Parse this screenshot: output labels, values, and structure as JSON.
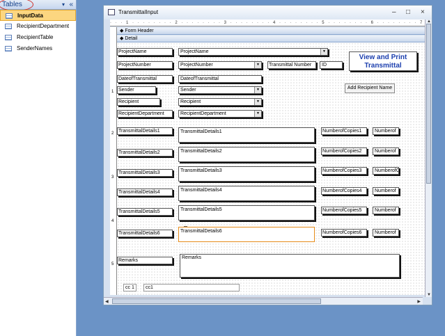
{
  "nav": {
    "title": "Tables",
    "items": [
      "InputData",
      "RecipientDepartment",
      "RecipientTable",
      "SenderNames"
    ]
  },
  "form": {
    "title": "TransmittalInput",
    "controls": {
      "minimize": "–",
      "restore": "□",
      "close": "×"
    },
    "sections": {
      "header": "Form Header",
      "detail": "Detail"
    },
    "ruler_top": "· · · 1 · · · · · · · · 2 · · · · · · · · 3 · · · · · · · · 4 · · · · · · · · 5 · · · · · · · · 6 · · · · · · · · 7",
    "ruler_left": [
      "1",
      "2",
      "3",
      "4",
      "5"
    ],
    "fields": {
      "project_name": {
        "label": "ProjectName",
        "value": "ProjectName"
      },
      "project_number": {
        "label": "ProjectNumber",
        "value": "ProjectNumber"
      },
      "transmittal_number": {
        "label": "Transmittal Number",
        "value": "ID"
      },
      "date": {
        "label": "DateofTransmittal",
        "value": "DateofTransmittal"
      },
      "sender": {
        "label": "Sender",
        "value": "Sender"
      },
      "recipient": {
        "label": "Recipient",
        "value": "Recipient"
      },
      "recipient_department": {
        "label": "RecipientDepartment",
        "value": "RecipientDepartment"
      },
      "details": [
        {
          "label": "TransmittalDetails1",
          "value": "TransmittalDetails1",
          "copies_label": "NumberofCopies1",
          "copies_value": "Numberof"
        },
        {
          "label": "TransmittalDetails2",
          "value": "TransmittalDetails2",
          "copies_label": "NumberofCopies2",
          "copies_value": "Numberof"
        },
        {
          "label": "TransmittalDetails3",
          "value": "TransmittalDetails3",
          "copies_label": "NumberofCopies3",
          "copies_value": "NumberofC"
        },
        {
          "label": "TransmittalDetails4",
          "value": "TransmittalDetails4",
          "copies_label": "NumberofCopies4",
          "copies_value": "Numberof"
        },
        {
          "label": "TransmittalDetails5",
          "value": "TransmittalDetails5",
          "copies_label": "NumberofCopies5",
          "copies_value": "Numberof"
        },
        {
          "label": "TransmittalDetails6",
          "value": "TransmittalDetails6",
          "copies_label": "NumberofCopies6",
          "copies_value": "Numberof"
        }
      ],
      "remarks": {
        "label": "Remarks",
        "value": "Remarks"
      },
      "cc1": {
        "label": "cc 1",
        "value": "cc1"
      }
    },
    "buttons": {
      "view_print": "View and Print Transmittal",
      "add_recipient": "Add Recipient Name"
    }
  }
}
